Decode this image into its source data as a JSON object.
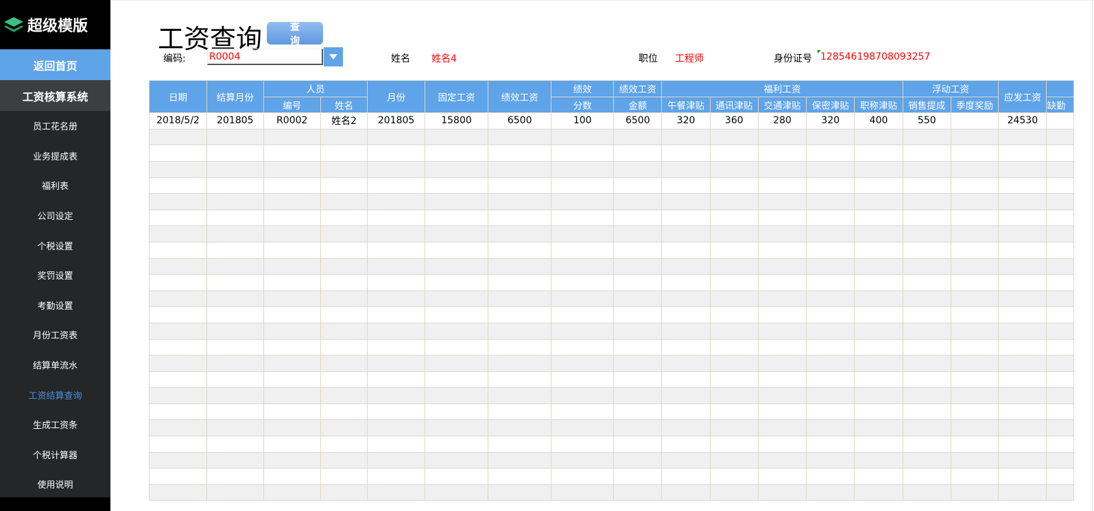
{
  "sidebar": {
    "logo": "超级模版",
    "home": "返回首页",
    "system": "工资核算系统",
    "items": [
      "员工花名册",
      "业务提成表",
      "福利表",
      "公司设定",
      "个税设置",
      "奖罚设置",
      "考勤设置",
      "月份工资表",
      "结算单流水",
      "工资结算查询",
      "生成工资条",
      "个税计算器",
      "使用说明"
    ],
    "active_index": 9
  },
  "header": {
    "title": "工资查询",
    "query_button": "查　询",
    "code_label": "编码:",
    "code_value": "R0004",
    "name_label": "姓名",
    "name_value": "姓名4",
    "position_label": "职位",
    "position_value": "工程师",
    "id_label": "身份证号",
    "id_value": "128546198708093257"
  },
  "table": {
    "headers": {
      "date": "日期",
      "month": "结算月份",
      "person": "人员",
      "code": "编号",
      "name": "姓名",
      "period": "月份",
      "fixed": "固定工资",
      "perf": "绩效工资",
      "score1": "绩效",
      "score2": "分数",
      "amount1": "绩效工资",
      "amount2": "金额",
      "welfare": "福利工资",
      "lunch": "午餐津贴",
      "comm": "通讯津贴",
      "traffic": "交通津贴",
      "secret": "保密津贴",
      "title_allow": "职称津贴",
      "float": "浮动工资",
      "sales": "销售提成",
      "quarter": "季度奖励",
      "payable": "应发工资",
      "absence": "缺勤"
    },
    "rows": [
      [
        "2018/5/2",
        "201805",
        "R0002",
        "姓名2",
        "201805",
        "15800",
        "6500",
        "100",
        "6500",
        "320",
        "360",
        "280",
        "320",
        "400",
        "550",
        "",
        "24530",
        ""
      ]
    ],
    "empty_rows": 23
  }
}
